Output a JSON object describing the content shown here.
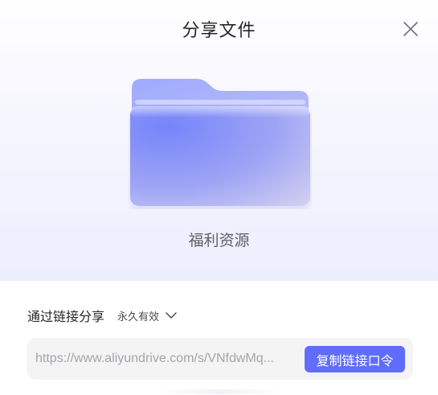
{
  "dialog": {
    "title": "分享文件",
    "close_icon": "close-icon"
  },
  "folder": {
    "icon": "folder-icon",
    "name": "福利资源",
    "colors": {
      "back": "#a7b3ff",
      "front_start": "#7b8bfb",
      "front_end": "#cac8f1"
    }
  },
  "share": {
    "label": "通过链接分享",
    "validity": "永久有效",
    "validity_icon": "chevron-down-icon"
  },
  "link": {
    "url": "https://www.aliyundrive.com/s/VNfdwMq...",
    "copy_label": "复制链接口令"
  },
  "colors": {
    "accent": "#5f6dfa",
    "text_primary": "#25262b",
    "text_muted": "#a4a5ab",
    "field_bg": "#f4f4f5"
  }
}
